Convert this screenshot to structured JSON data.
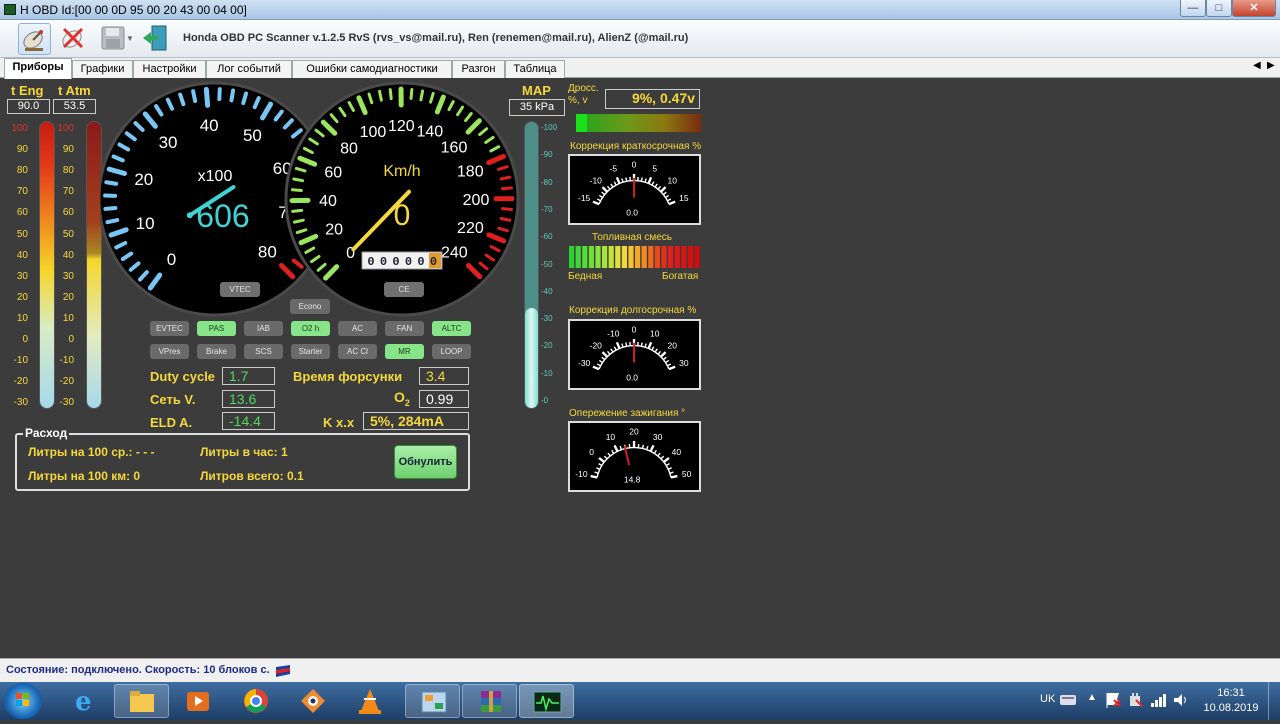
{
  "window": {
    "title": "H OBD Id:[00 00 0D 95 00 20 43 00 04 00]",
    "app_title": "Honda OBD PC Scanner v.1.2.5  RvS (rvs_vs@mail.ru), Ren (renemen@mail.ru), AlienZ (@mail.ru)"
  },
  "tabs": [
    "Приборы",
    "Графики",
    "Настройки",
    "Лог событий",
    "Ошибки самодиагностики",
    "Разгон",
    "Таблица"
  ],
  "temps": {
    "eng_label": "t Eng",
    "eng_value": "90.0",
    "atm_label": "t Atm",
    "atm_value": "53.5",
    "scale": [
      "100",
      "90",
      "80",
      "70",
      "60",
      "50",
      "40",
      "30",
      "20",
      "10",
      "0",
      "-10",
      "-20",
      "-30"
    ]
  },
  "tach": {
    "ticks": [
      "0",
      "10",
      "20",
      "30",
      "40",
      "50",
      "60",
      "70",
      "80"
    ],
    "unit": "x100",
    "value": "606",
    "button": "VTEC"
  },
  "speedo": {
    "ticks": [
      "0",
      "20",
      "40",
      "60",
      "80",
      "100",
      "120",
      "140",
      "160",
      "180",
      "200",
      "220",
      "240"
    ],
    "unit": "Km/h",
    "value": "0",
    "odometer": [
      "0",
      "0",
      "0",
      "0",
      "0",
      "0"
    ],
    "button": "CE"
  },
  "map": {
    "label": "MAP",
    "value": "35 kPa",
    "scale": [
      "100",
      "90",
      "80",
      "70",
      "60",
      "50",
      "40",
      "30",
      "20",
      "10",
      "0"
    ]
  },
  "indicators": {
    "econo": "Econo",
    "row1": [
      {
        "label": "EVTEC",
        "on": false
      },
      {
        "label": "PAS",
        "on": true
      },
      {
        "label": "IAB",
        "on": false
      },
      {
        "label": "O2 h",
        "on": true
      },
      {
        "label": "AC",
        "on": false
      },
      {
        "label": "FAN",
        "on": false
      },
      {
        "label": "ALTC",
        "on": true
      }
    ],
    "row2": [
      {
        "label": "VPres",
        "on": false
      },
      {
        "label": "Brake",
        "on": false
      },
      {
        "label": "SCS",
        "on": false
      },
      {
        "label": "Starter",
        "on": false
      },
      {
        "label": "AC Cl",
        "on": false
      },
      {
        "label": "MR",
        "on": true
      },
      {
        "label": "LOOP",
        "on": false
      }
    ]
  },
  "readouts": {
    "duty_label": "Duty cycle",
    "duty_value": "1.7",
    "net_label": "Сеть V.",
    "net_value": "13.6",
    "eld_label": "ELD  A.",
    "eld_value": "-14.4",
    "inj_label": "Время  форсунки",
    "inj_value": "3.4",
    "o2_label": "O",
    "o2_sub": "2",
    "o2_value": "0.99",
    "kxx_label": "K x.x",
    "kxx_value": "5%, 284mA"
  },
  "consumption": {
    "legend": "Расход",
    "avg": "Литры на 100 ср.: - - -",
    "per100": "Литры на 100 км: 0",
    "per_hour": "Литры в час: 1",
    "total": "Литров всего: 0.1",
    "reset": "Обнулить"
  },
  "right": {
    "throttle_label1": "Дросс.",
    "throttle_label2": "%, v",
    "throttle_value": "9%, 0.47v",
    "throttle_fraction": 0.09,
    "stft_title": "Коррекция краткосрочная %",
    "stft_ticks": [
      "-15",
      "-10",
      "-5",
      "0",
      "5",
      "10",
      "15"
    ],
    "stft_value": "0.0",
    "mix_title": "Топливная смесь",
    "mix_lean": "Бедная",
    "mix_rich": "Богатая",
    "ltft_title": "Коррекция долгосрочная %",
    "ltft_ticks": [
      "-30",
      "-20",
      "-10",
      "0",
      "10",
      "20",
      "30"
    ],
    "ltft_value": "0.0",
    "ign_title": "Опережение зажигания °",
    "ign_ticks": [
      "-10",
      "0",
      "10",
      "20",
      "30",
      "40",
      "50"
    ],
    "ign_value": "14.8"
  },
  "status": {
    "text": "Состояние: подключено. Скорость: 10 блоков с."
  },
  "taskbar": {
    "lang": "UK",
    "time": "16:31",
    "date": "10.08.2019"
  },
  "colors": {
    "accent_yellow": "#f5d83a",
    "value_green": "#4fd95c",
    "gauge_blue": "#7ac7f5",
    "speed_green": "#9ae65c",
    "redline": "#e02020"
  }
}
